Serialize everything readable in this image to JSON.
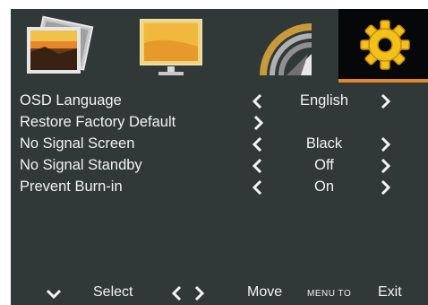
{
  "tabs": [
    {
      "name": "picture-tab",
      "icon": "photo-icon",
      "active": false
    },
    {
      "name": "display-tab",
      "icon": "monitor-icon",
      "active": false
    },
    {
      "name": "wireless-tab",
      "icon": "signal-icon",
      "active": false
    },
    {
      "name": "setup-tab",
      "icon": "gear-icon",
      "active": true
    }
  ],
  "menu": {
    "items": [
      {
        "label": "OSD Language",
        "value": "English"
      },
      {
        "label": "Restore Factory Default",
        "value": ""
      },
      {
        "label": "No  Signal Screen",
        "value": "Black"
      },
      {
        "label": "No  Signal Standby",
        "value": "Off"
      },
      {
        "label": "Prevent  Burn-in",
        "value": "On"
      }
    ]
  },
  "footer": {
    "select_label": "Select",
    "move_label": "Move",
    "menu_to_label": "MENU TO",
    "exit_label": "Exit"
  },
  "colors": {
    "background": "#303838",
    "active_tab": "#050708",
    "accent": "#e08a2c",
    "text": "#f3f3f3"
  }
}
